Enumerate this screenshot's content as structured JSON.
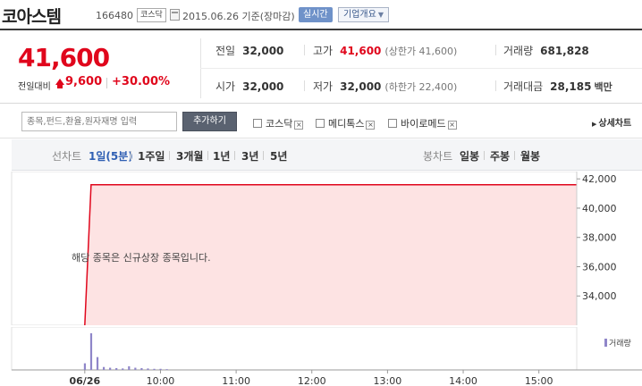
{
  "header": {
    "name": "코아스템",
    "code": "166480",
    "market_badge": "코스닥",
    "date_text": "2015.06.26 기준(장마감)",
    "realtime_label": "실시간",
    "company_info_label": "기업개요"
  },
  "summary": {
    "price": "41,600",
    "change_label": "전일대비",
    "change": "9,600",
    "change_pct": "+30.00%",
    "prev_close": {
      "label": "전일",
      "value": "32,000"
    },
    "high": {
      "label": "고가",
      "value": "41,600",
      "sub": "(상한가 41,600)"
    },
    "volume": {
      "label": "거래량",
      "value": "681,828"
    },
    "open": {
      "label": "시가",
      "value": "32,000"
    },
    "low": {
      "label": "저가",
      "value": "32,000",
      "sub": "(하한가 22,400)"
    },
    "amount": {
      "label": "거래대금",
      "value": "28,185",
      "unit": "백만"
    }
  },
  "compare": {
    "search_placeholder": "종목,펀드,환율,원자재명 입력",
    "add_label": "추가하기",
    "checks": [
      {
        "label": "코스닥",
        "checked": false
      },
      {
        "label": "메디톡스",
        "checked": false
      },
      {
        "label": "바이로메드",
        "checked": false
      }
    ],
    "detail_label": "상세차트"
  },
  "periods": {
    "line_label": "선차트",
    "items": [
      "1일(5분)",
      "1주일",
      "3개월",
      "1년",
      "3년",
      "5년"
    ],
    "selected": 0,
    "candle_label": "봉차트",
    "candle_items": [
      "일봉",
      "주봉",
      "월봉"
    ]
  },
  "notice": "해당 종목은 신규상장 종목입니다.",
  "volume_legend": "거래량",
  "colors": {
    "up": "#e0061c",
    "area_fill": "#fde3e3",
    "volume": "#8f86c9",
    "selected": "#2f5fb3"
  },
  "chart_data": {
    "type": "area",
    "y_ticks": [
      "42,000",
      "40,000",
      "38,000",
      "36,000",
      "34,000"
    ],
    "ylim": [
      32000,
      42500
    ],
    "x_ticks": [
      "06/26",
      "10:00",
      "11:00",
      "12:00",
      "13:00",
      "14:00",
      "15:00"
    ],
    "series": [
      {
        "x": [
          "09:00",
          "09:05",
          "15:30"
        ],
        "y": [
          32000,
          41600,
          41600
        ]
      }
    ],
    "volume": {
      "x": [
        "09:00",
        "09:05",
        "09:10",
        "09:15",
        "09:20",
        "09:25",
        "09:30",
        "09:35",
        "09:40",
        "09:45",
        "09:50",
        "09:55",
        "10:00",
        "10:05"
      ],
      "y": [
        18,
        100,
        35,
        8,
        6,
        5,
        4,
        10,
        6,
        5,
        4,
        3,
        3,
        2
      ]
    }
  }
}
